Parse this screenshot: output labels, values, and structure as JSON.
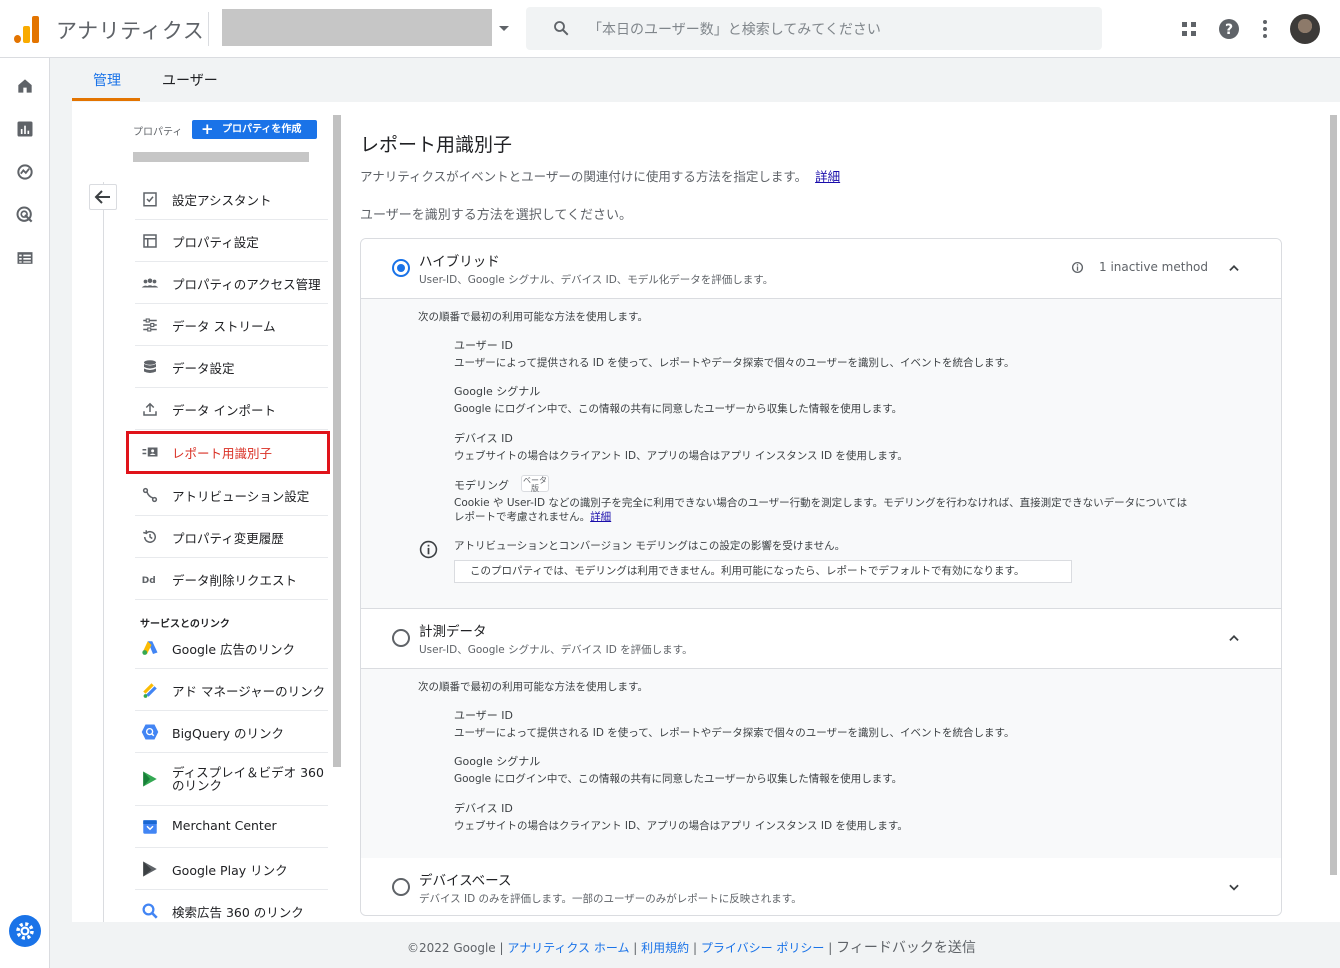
{
  "app": {
    "title": "アナリティクス"
  },
  "search": {
    "placeholder": "「本日のユーザー数」と検索してみてください"
  },
  "tabs": [
    {
      "label": "管理"
    },
    {
      "label": "ユーザー"
    }
  ],
  "property": {
    "label": "プロパティ",
    "create_button": "プロパティを作成"
  },
  "nav": {
    "items": [
      {
        "label": "設定アシスタント",
        "icon": "checklist-icon"
      },
      {
        "label": "プロパティ設定",
        "icon": "property-settings-icon"
      },
      {
        "label": "プロパティのアクセス管理",
        "icon": "people-icon"
      },
      {
        "label": "データ ストリーム",
        "icon": "streams-icon"
      },
      {
        "label": "データ設定",
        "icon": "database-icon"
      },
      {
        "label": "データ インポート",
        "icon": "upload-icon"
      },
      {
        "label": "レポート用識別子",
        "icon": "identity-icon"
      },
      {
        "label": "アトリビューション設定",
        "icon": "attribution-icon"
      },
      {
        "label": "プロパティ変更履歴",
        "icon": "history-icon"
      },
      {
        "label": "データ削除リクエスト",
        "icon": "data-deletion-icon"
      }
    ],
    "links_section": "サービスとのリンク",
    "links": [
      {
        "label": "Google 広告のリンク",
        "icon": "google-ads-icon"
      },
      {
        "label": "アド マネージャーのリンク",
        "icon": "ad-manager-icon"
      },
      {
        "label": "BigQuery のリンク",
        "icon": "bigquery-icon"
      },
      {
        "label": "ディスプレイ＆ビデオ 360",
        "label2": "のリンク",
        "icon": "dv360-icon"
      },
      {
        "label": "Merchant Center",
        "icon": "merchant-center-icon"
      },
      {
        "label": "Google Play リンク",
        "icon": "google-play-icon"
      },
      {
        "label": "検索広告 360 のリンク",
        "icon": "search-ads-360-icon"
      }
    ]
  },
  "main": {
    "title": "レポート用識別子",
    "description": "アナリティクスがイベントとユーザーの関連付けに使用する方法を指定します。",
    "details_link": "詳細",
    "choose_label": "ユーザーを識別する方法を選択してください。",
    "options": {
      "hybrid": {
        "title": "ハイブリッド",
        "subtitle": "User-ID、Google シグナル、デバイス ID、モデル化データを評価します。",
        "inactive": "1 inactive method",
        "intro": "次の順番で最初の利用可能な方法を使用します。",
        "methods": [
          {
            "title": "ユーザー ID",
            "desc": "ユーザーによって提供される ID を使って、レポートやデータ探索で個々のユーザーを識別し、イベントを統合します。"
          },
          {
            "title": "Google シグナル",
            "desc": "Google にログイン中で、この情報の共有に同意したユーザーから収集した情報を使用します。"
          },
          {
            "title": "デバイス ID",
            "desc": "ウェブサイトの場合はクライアント ID、アプリの場合はアプリ インスタンス ID を使用します。"
          }
        ],
        "modeling": {
          "title": "モデリング",
          "beta": "ベータ版",
          "desc1": "Cookie や User-ID などの識別子を完全に利用できない場合のユーザー行動を測定します。モデリングを行わなければ、直接測定できないデータについては",
          "desc2": "レポートで考慮されません。",
          "link": "詳細"
        },
        "attribution_note": "アトリビューションとコンバージョン モデリングはこの設定の影響を受けません。",
        "unavailable": "このプロパティでは、モデリングは利用できません。利用可能になったら、レポートでデフォルトで有効になります。"
      },
      "observed": {
        "title": "計測データ",
        "subtitle": "User-ID、Google シグナル、デバイス ID を評価します。",
        "intro": "次の順番で最初の利用可能な方法を使用します。",
        "methods": [
          {
            "title": "ユーザー ID",
            "desc": "ユーザーによって提供される ID を使って、レポートやデータ探索で個々のユーザーを識別し、イベントを統合します。"
          },
          {
            "title": "Google シグナル",
            "desc": "Google にログイン中で、この情報の共有に同意したユーザーから収集した情報を使用します。"
          },
          {
            "title": "デバイス ID",
            "desc": "ウェブサイトの場合はクライアント ID、アプリの場合はアプリ インスタンス ID を使用します。"
          }
        ]
      },
      "device": {
        "title": "デバイスベース",
        "subtitle": "デバイス ID のみを評価します。一部のユーザーのみがレポートに反映されます。"
      }
    }
  },
  "footer": {
    "copyright": "©2022 Google",
    "home": "アナリティクス ホーム",
    "terms": "利用規約",
    "privacy": "プライバシー ポリシー",
    "feedback": "フィードバックを送信"
  },
  "colors": {
    "accent": "#1a73e8",
    "selected": "#d93025",
    "highlight_box": "#e0131a",
    "tab_underline": "#e37400"
  }
}
